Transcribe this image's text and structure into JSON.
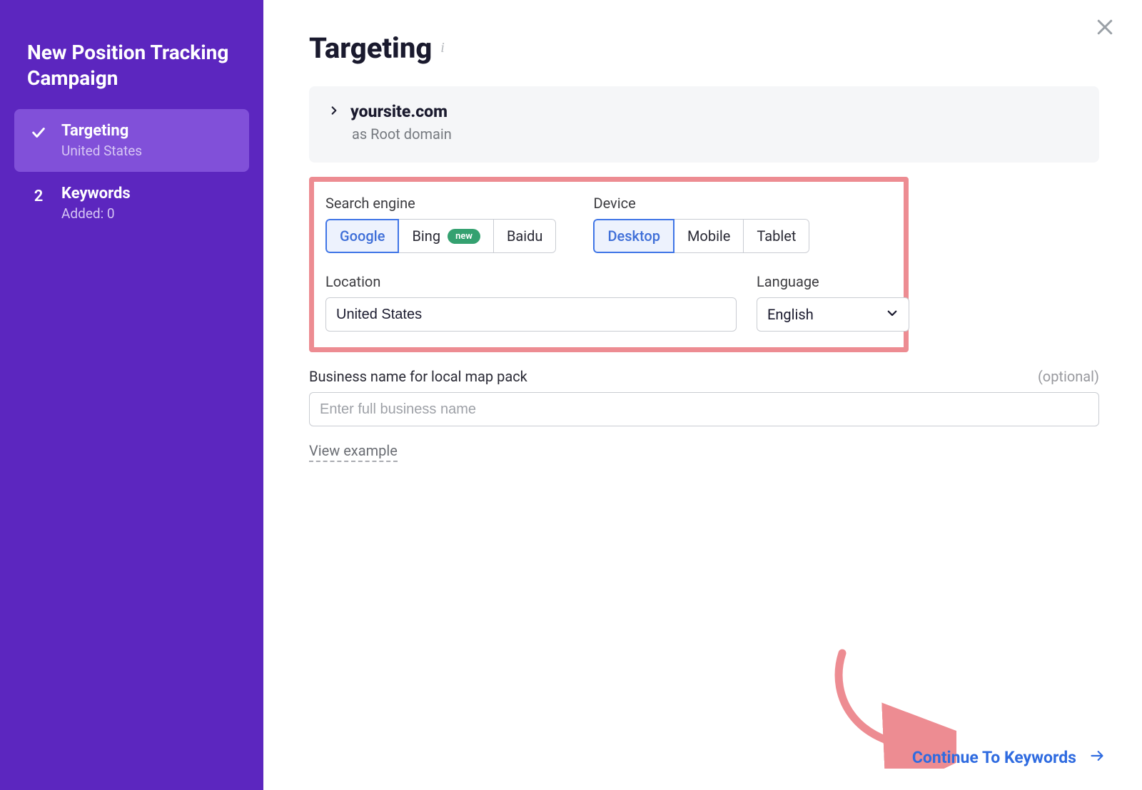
{
  "sidebar": {
    "title": "New Position Tracking Campaign",
    "steps": [
      {
        "title": "Targeting",
        "sub": "United States"
      },
      {
        "num": "2",
        "title": "Keywords",
        "sub": "Added: 0"
      }
    ]
  },
  "page": {
    "title": "Targeting"
  },
  "domain": {
    "name": "yoursite.com",
    "sub": "as Root domain"
  },
  "targeting": {
    "search_engine_label": "Search engine",
    "search_engine_options": [
      "Google",
      "Bing",
      "Baidu"
    ],
    "search_engine_badge": "new",
    "device_label": "Device",
    "device_options": [
      "Desktop",
      "Mobile",
      "Tablet"
    ],
    "location_label": "Location",
    "location_value": "United States",
    "language_label": "Language",
    "language_value": "English"
  },
  "business": {
    "label": "Business name for local map pack",
    "optional": "(optional)",
    "placeholder": "Enter full business name",
    "example": "View example"
  },
  "actions": {
    "continue": "Continue To Keywords"
  }
}
